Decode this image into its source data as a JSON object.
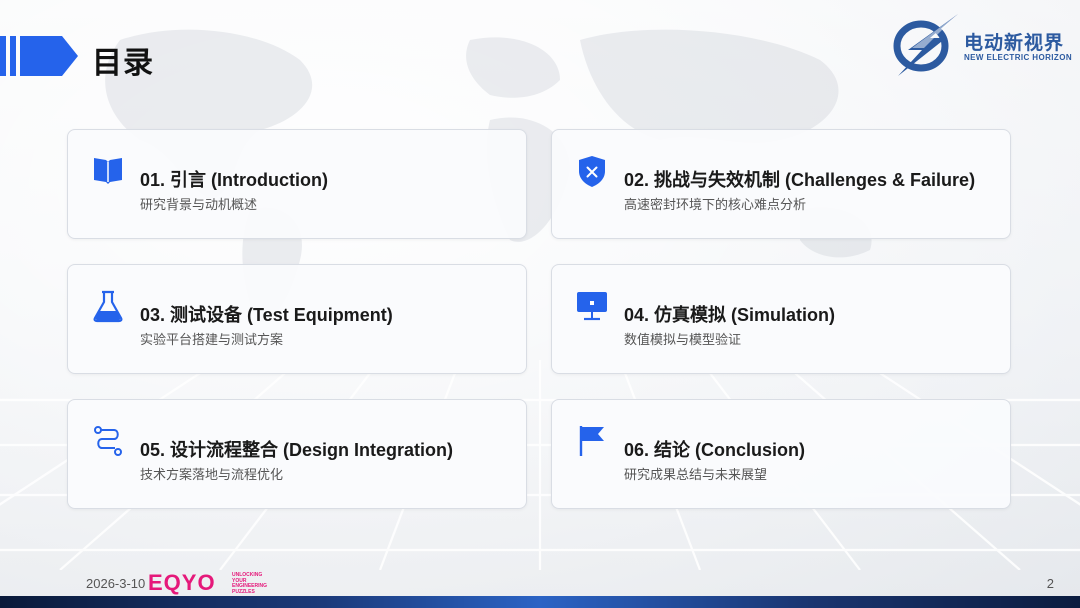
{
  "page": {
    "title": "目录",
    "date": "2026-3-10",
    "page_number": "2"
  },
  "logo": {
    "name_cn": "电动新视界",
    "name_en": "NEW ELECTRIC HORIZON"
  },
  "footer": {
    "brand": "EQYO",
    "tagline": "UNLOCKING YOUR ENGINEERING PUZZLES"
  },
  "colors": {
    "accent": "#2563eb",
    "brand_pink": "#e5197a",
    "logo_blue": "#2c5aa0"
  },
  "sections": [
    {
      "title": "01. 引言 (Introduction)",
      "subtitle": "研究背景与动机概述",
      "icon": "book-icon"
    },
    {
      "title": "02. 挑战与失效机制 (Challenges & Failure)",
      "subtitle": "高速密封环境下的核心难点分析",
      "icon": "shield-x-icon"
    },
    {
      "title": "03. 测试设备 (Test Equipment)",
      "subtitle": "实验平台搭建与测试方案",
      "icon": "flask-icon"
    },
    {
      "title": "04. 仿真模拟 (Simulation)",
      "subtitle": "数值模拟与模型验证",
      "icon": "monitor-icon"
    },
    {
      "title": "05. 设计流程整合 (Design Integration)",
      "subtitle": "技术方案落地与流程优化",
      "icon": "route-icon"
    },
    {
      "title": "06. 结论 (Conclusion)",
      "subtitle": "研究成果总结与未来展望",
      "icon": "flag-icon"
    }
  ]
}
